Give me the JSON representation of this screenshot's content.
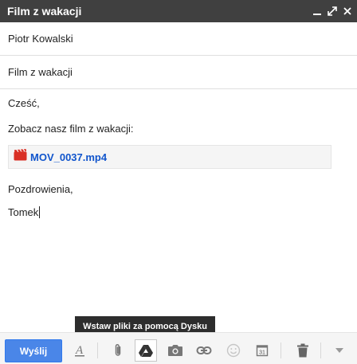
{
  "window": {
    "title": "Film z wakacji",
    "controls": [
      "minimize-icon",
      "expand-icon",
      "close-icon"
    ]
  },
  "to": {
    "value": "Piotr Kowalski"
  },
  "subject": {
    "value": "Film z wakacji"
  },
  "body": {
    "greeting": "Cześć,",
    "line1": "Zobacz nasz film z wakacji:",
    "closing": "Pozdrowienia,",
    "signature": "Tomek"
  },
  "attachment": {
    "name": "MOV_0037.mp4",
    "icon": "video-file-icon",
    "color": "#d93025"
  },
  "tooltip": {
    "text": "Wstaw pliki za pomocą Dysku"
  },
  "toolbar": {
    "send_label": "Wyślij",
    "send_color": "#4a86e8",
    "calendar_day": "31",
    "icons": [
      "formatting-icon",
      "paperclip-icon",
      "drive-icon",
      "camera-icon",
      "link-icon",
      "emoji-icon",
      "calendar-icon",
      "trash-icon",
      "more-options-icon"
    ]
  }
}
